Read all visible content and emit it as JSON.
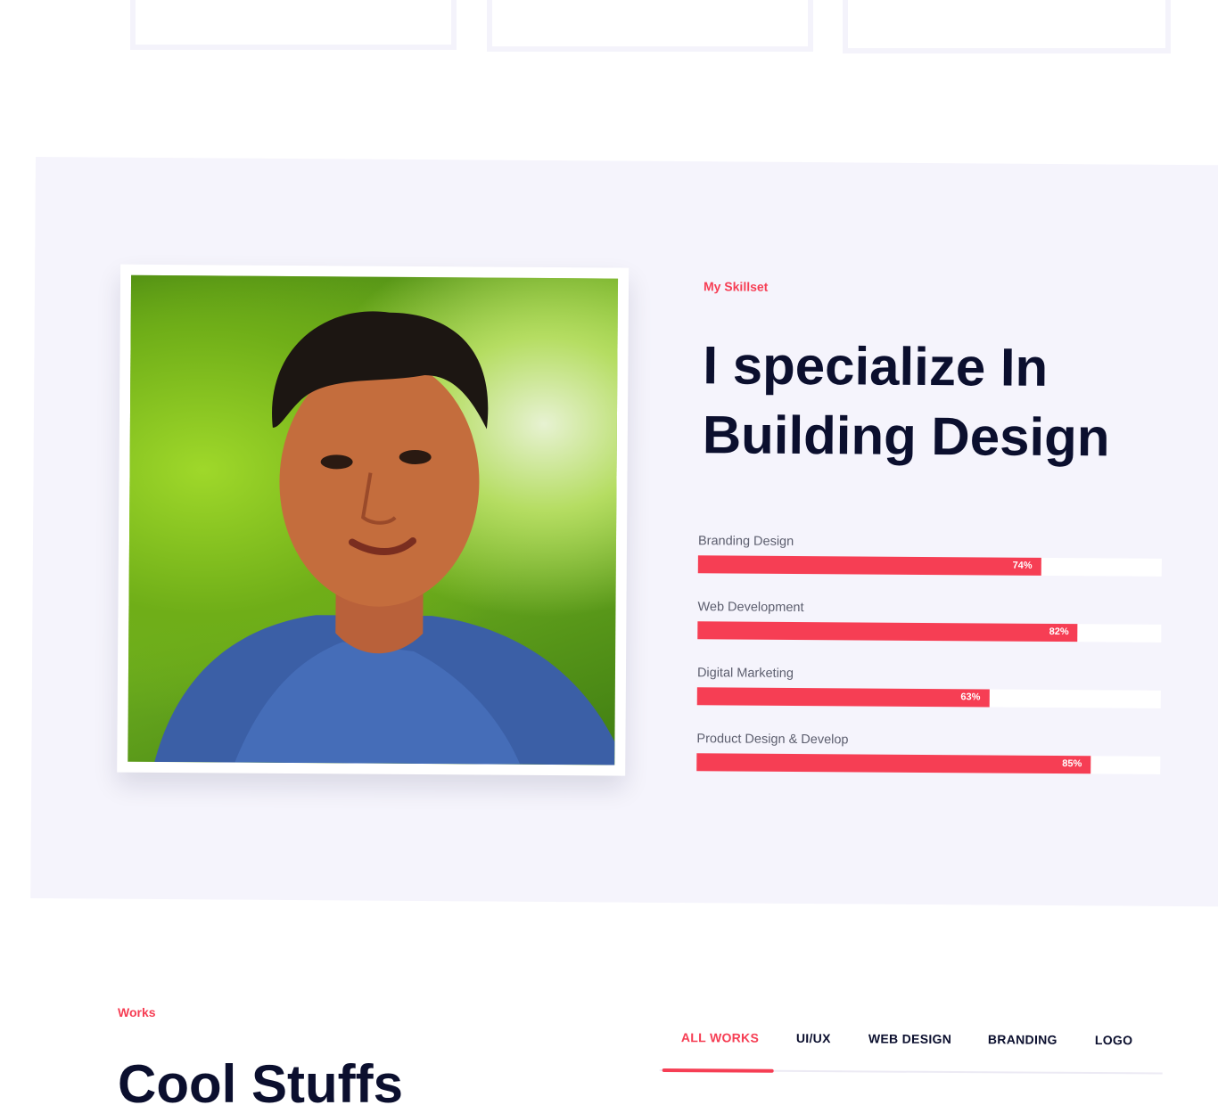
{
  "skills_section": {
    "eyebrow": "My Skillset",
    "headline_line1": "I specialize In",
    "headline_line2": "Building Design",
    "skills": [
      {
        "label": "Branding Design",
        "percent_label": "74%",
        "value": 74
      },
      {
        "label": "Web Development",
        "percent_label": "82%",
        "value": 82
      },
      {
        "label": "Digital Marketing",
        "percent_label": "63%",
        "value": 63
      },
      {
        "label": "Product Design & Develop",
        "percent_label": "85%",
        "value": 85
      }
    ]
  },
  "works_section": {
    "eyebrow": "Works",
    "title": "Cool Stuffs",
    "tabs": [
      {
        "label": "ALL WORKS",
        "active": true
      },
      {
        "label": "UI/UX"
      },
      {
        "label": "WEB DESIGN"
      },
      {
        "label": "BRANDING"
      },
      {
        "label": "LOGO"
      }
    ]
  },
  "colors": {
    "accent": "#f63e54",
    "heading": "#0b0f2e",
    "section_bg": "#f5f4fc"
  }
}
